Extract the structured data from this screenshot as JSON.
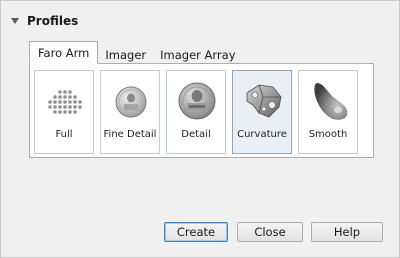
{
  "section": {
    "title": "Profiles",
    "expand_icon": "collapse-triangle-icon"
  },
  "tabs": [
    {
      "label": "Faro Arm",
      "active": true
    },
    {
      "label": "Imager",
      "active": false
    },
    {
      "label": "Imager Array",
      "active": false
    }
  ],
  "profiles": [
    {
      "label": "Full",
      "icon": "point-cloud-icon",
      "selected": false
    },
    {
      "label": "Fine Detail",
      "icon": "coin-fine-icon",
      "selected": false
    },
    {
      "label": "Detail",
      "icon": "coin-detail-icon",
      "selected": false
    },
    {
      "label": "Curvature",
      "icon": "part-curvature-icon",
      "selected": true
    },
    {
      "label": "Smooth",
      "icon": "smooth-shape-icon",
      "selected": false
    }
  ],
  "buttons": {
    "create": "Create",
    "close": "Close",
    "help": "Help"
  },
  "colors": {
    "selected_tile": "#e9eff5",
    "default_button_border": "#3c7fb1"
  }
}
